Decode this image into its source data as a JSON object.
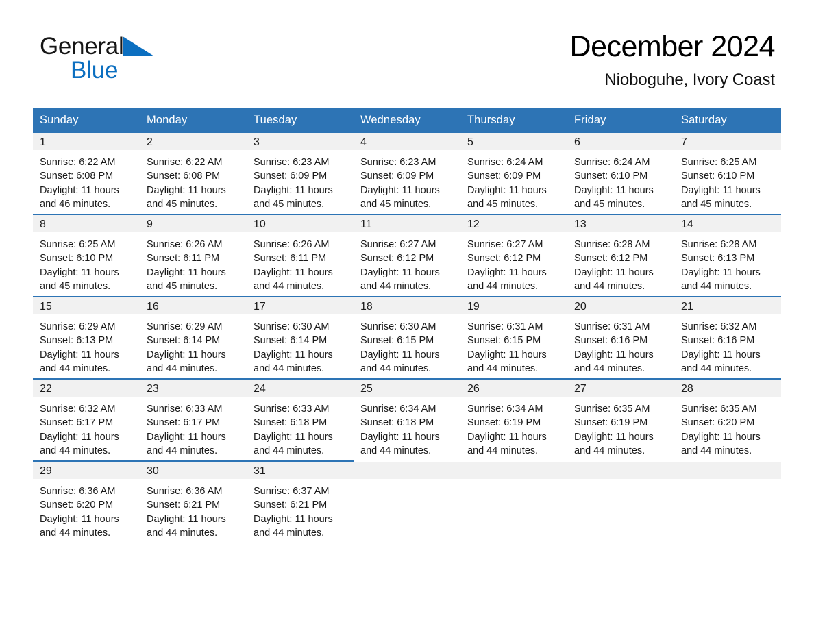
{
  "brand": {
    "word1": "General",
    "word2": "Blue",
    "triangle_color": "#0c6fc0",
    "icon": "triangle-logo"
  },
  "header": {
    "title": "December 2024",
    "location": "Nioboguhe, Ivory Coast"
  },
  "theme": {
    "header_blue": "#2d74b5",
    "daynum_strip": "#f1f1f1",
    "brand_blue": "#0c6fc0",
    "text": "#1a1a1a"
  },
  "calendar": {
    "weekday_headers": [
      "Sunday",
      "Monday",
      "Tuesday",
      "Wednesday",
      "Thursday",
      "Friday",
      "Saturday"
    ],
    "weeks": [
      [
        {
          "day": "1",
          "info": "Sunrise: 6:22 AM\nSunset: 6:08 PM\nDaylight: 11 hours\nand 46 minutes."
        },
        {
          "day": "2",
          "info": "Sunrise: 6:22 AM\nSunset: 6:08 PM\nDaylight: 11 hours\nand 45 minutes."
        },
        {
          "day": "3",
          "info": "Sunrise: 6:23 AM\nSunset: 6:09 PM\nDaylight: 11 hours\nand 45 minutes."
        },
        {
          "day": "4",
          "info": "Sunrise: 6:23 AM\nSunset: 6:09 PM\nDaylight: 11 hours\nand 45 minutes."
        },
        {
          "day": "5",
          "info": "Sunrise: 6:24 AM\nSunset: 6:09 PM\nDaylight: 11 hours\nand 45 minutes."
        },
        {
          "day": "6",
          "info": "Sunrise: 6:24 AM\nSunset: 6:10 PM\nDaylight: 11 hours\nand 45 minutes."
        },
        {
          "day": "7",
          "info": "Sunrise: 6:25 AM\nSunset: 6:10 PM\nDaylight: 11 hours\nand 45 minutes."
        }
      ],
      [
        {
          "day": "8",
          "info": "Sunrise: 6:25 AM\nSunset: 6:10 PM\nDaylight: 11 hours\nand 45 minutes."
        },
        {
          "day": "9",
          "info": "Sunrise: 6:26 AM\nSunset: 6:11 PM\nDaylight: 11 hours\nand 45 minutes."
        },
        {
          "day": "10",
          "info": "Sunrise: 6:26 AM\nSunset: 6:11 PM\nDaylight: 11 hours\nand 44 minutes."
        },
        {
          "day": "11",
          "info": "Sunrise: 6:27 AM\nSunset: 6:12 PM\nDaylight: 11 hours\nand 44 minutes."
        },
        {
          "day": "12",
          "info": "Sunrise: 6:27 AM\nSunset: 6:12 PM\nDaylight: 11 hours\nand 44 minutes."
        },
        {
          "day": "13",
          "info": "Sunrise: 6:28 AM\nSunset: 6:12 PM\nDaylight: 11 hours\nand 44 minutes."
        },
        {
          "day": "14",
          "info": "Sunrise: 6:28 AM\nSunset: 6:13 PM\nDaylight: 11 hours\nand 44 minutes."
        }
      ],
      [
        {
          "day": "15",
          "info": "Sunrise: 6:29 AM\nSunset: 6:13 PM\nDaylight: 11 hours\nand 44 minutes."
        },
        {
          "day": "16",
          "info": "Sunrise: 6:29 AM\nSunset: 6:14 PM\nDaylight: 11 hours\nand 44 minutes."
        },
        {
          "day": "17",
          "info": "Sunrise: 6:30 AM\nSunset: 6:14 PM\nDaylight: 11 hours\nand 44 minutes."
        },
        {
          "day": "18",
          "info": "Sunrise: 6:30 AM\nSunset: 6:15 PM\nDaylight: 11 hours\nand 44 minutes."
        },
        {
          "day": "19",
          "info": "Sunrise: 6:31 AM\nSunset: 6:15 PM\nDaylight: 11 hours\nand 44 minutes."
        },
        {
          "day": "20",
          "info": "Sunrise: 6:31 AM\nSunset: 6:16 PM\nDaylight: 11 hours\nand 44 minutes."
        },
        {
          "day": "21",
          "info": "Sunrise: 6:32 AM\nSunset: 6:16 PM\nDaylight: 11 hours\nand 44 minutes."
        }
      ],
      [
        {
          "day": "22",
          "info": "Sunrise: 6:32 AM\nSunset: 6:17 PM\nDaylight: 11 hours\nand 44 minutes."
        },
        {
          "day": "23",
          "info": "Sunrise: 6:33 AM\nSunset: 6:17 PM\nDaylight: 11 hours\nand 44 minutes."
        },
        {
          "day": "24",
          "info": "Sunrise: 6:33 AM\nSunset: 6:18 PM\nDaylight: 11 hours\nand 44 minutes."
        },
        {
          "day": "25",
          "info": "Sunrise: 6:34 AM\nSunset: 6:18 PM\nDaylight: 11 hours\nand 44 minutes."
        },
        {
          "day": "26",
          "info": "Sunrise: 6:34 AM\nSunset: 6:19 PM\nDaylight: 11 hours\nand 44 minutes."
        },
        {
          "day": "27",
          "info": "Sunrise: 6:35 AM\nSunset: 6:19 PM\nDaylight: 11 hours\nand 44 minutes."
        },
        {
          "day": "28",
          "info": "Sunrise: 6:35 AM\nSunset: 6:20 PM\nDaylight: 11 hours\nand 44 minutes."
        }
      ],
      [
        {
          "day": "29",
          "info": "Sunrise: 6:36 AM\nSunset: 6:20 PM\nDaylight: 11 hours\nand 44 minutes."
        },
        {
          "day": "30",
          "info": "Sunrise: 6:36 AM\nSunset: 6:21 PM\nDaylight: 11 hours\nand 44 minutes."
        },
        {
          "day": "31",
          "info": "Sunrise: 6:37 AM\nSunset: 6:21 PM\nDaylight: 11 hours\nand 44 minutes."
        },
        {
          "day": "",
          "info": ""
        },
        {
          "day": "",
          "info": ""
        },
        {
          "day": "",
          "info": ""
        },
        {
          "day": "",
          "info": ""
        }
      ]
    ]
  }
}
